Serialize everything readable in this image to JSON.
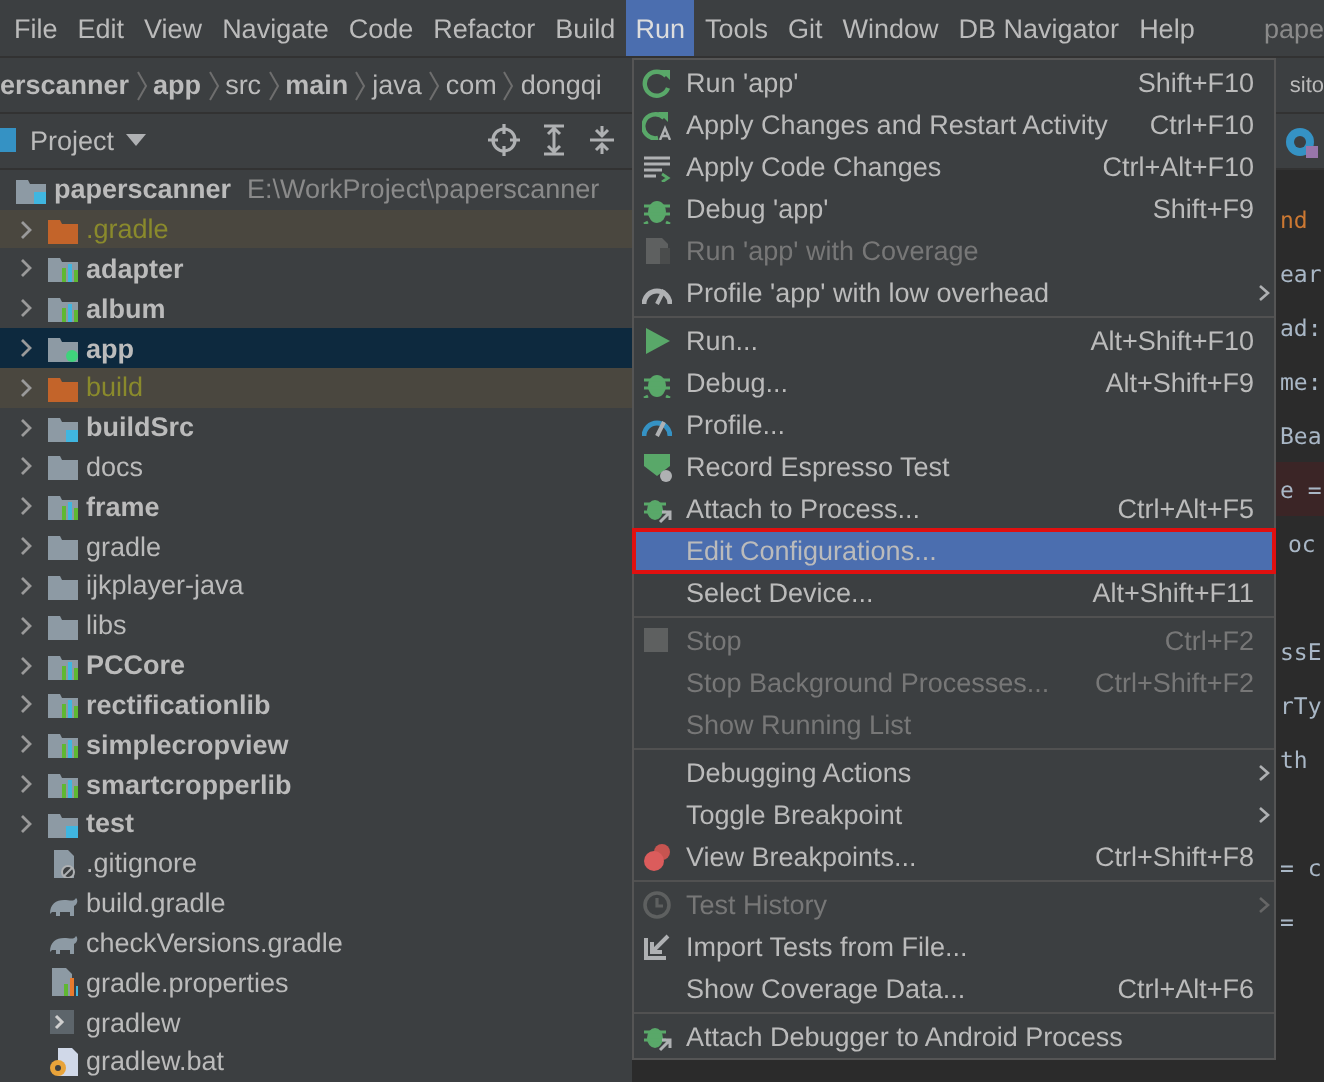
{
  "menu_bar": {
    "items": [
      {
        "label": "File",
        "selected": false
      },
      {
        "label": "Edit",
        "selected": false
      },
      {
        "label": "View",
        "selected": false
      },
      {
        "label": "Navigate",
        "selected": false
      },
      {
        "label": "Code",
        "selected": false
      },
      {
        "label": "Refactor",
        "selected": false
      },
      {
        "label": "Build",
        "selected": false
      },
      {
        "label": "Run",
        "selected": true
      },
      {
        "label": "Tools",
        "selected": false
      },
      {
        "label": "Git",
        "selected": false
      },
      {
        "label": "Window",
        "selected": false
      },
      {
        "label": "DB Navigator",
        "selected": false
      },
      {
        "label": "Help",
        "selected": false
      }
    ],
    "project_title": "pape"
  },
  "breadcrumb": {
    "items": [
      {
        "label": "erscanner",
        "bold": true
      },
      {
        "label": "app",
        "bold": true
      },
      {
        "label": "src",
        "bold": false
      },
      {
        "label": "main",
        "bold": true
      },
      {
        "label": "java",
        "bold": false
      },
      {
        "label": "com",
        "bold": false
      },
      {
        "label": "dongqi",
        "bold": false
      }
    ],
    "right_fragment": "sito"
  },
  "project_panel": {
    "title": "Project",
    "tree": [
      {
        "name": "paperscanner",
        "path": "E:\\WorkProject\\paperscanner",
        "kind": "source-root",
        "bold": true,
        "selected": false,
        "children": [
          {
            "name": ".gradle",
            "kind": "excluded",
            "bold": false,
            "selected": false,
            "expanded": false
          },
          {
            "name": "adapter",
            "kind": "module",
            "bold": true,
            "selected": false,
            "expanded": false
          },
          {
            "name": "album",
            "kind": "module",
            "bold": true,
            "selected": false,
            "expanded": false
          },
          {
            "name": "app",
            "kind": "app-module",
            "bold": true,
            "selected": true,
            "expanded": false
          },
          {
            "name": "build",
            "kind": "excluded",
            "bold": false,
            "selected": false,
            "expanded": false
          },
          {
            "name": "buildSrc",
            "kind": "source-root",
            "bold": true,
            "selected": false,
            "expanded": false
          },
          {
            "name": "docs",
            "kind": "folder",
            "bold": false,
            "selected": false,
            "expanded": false
          },
          {
            "name": "frame",
            "kind": "module",
            "bold": true,
            "selected": false,
            "expanded": false
          },
          {
            "name": "gradle",
            "kind": "folder",
            "bold": false,
            "selected": false,
            "expanded": false
          },
          {
            "name": "ijkplayer-java",
            "kind": "folder",
            "bold": false,
            "selected": false,
            "expanded": false
          },
          {
            "name": "libs",
            "kind": "folder",
            "bold": false,
            "selected": false,
            "expanded": false
          },
          {
            "name": "PCCore",
            "kind": "module",
            "bold": true,
            "selected": false,
            "expanded": false
          },
          {
            "name": "rectificationlib",
            "kind": "module",
            "bold": true,
            "selected": false,
            "expanded": false
          },
          {
            "name": "simplecropview",
            "kind": "module",
            "bold": true,
            "selected": false,
            "expanded": false
          },
          {
            "name": "smartcropperlib",
            "kind": "module",
            "bold": true,
            "selected": false,
            "expanded": false
          },
          {
            "name": "test",
            "kind": "source-root",
            "bold": true,
            "selected": false,
            "expanded": false
          },
          {
            "name": ".gitignore",
            "kind": "ignore-file",
            "bold": false,
            "selected": false
          },
          {
            "name": "build.gradle",
            "kind": "gradle-file",
            "bold": false,
            "selected": false
          },
          {
            "name": "checkVersions.gradle",
            "kind": "gradle-file",
            "bold": false,
            "selected": false
          },
          {
            "name": "gradle.properties",
            "kind": "properties-file",
            "bold": false,
            "selected": false
          },
          {
            "name": "gradlew",
            "kind": "script-file",
            "bold": false,
            "selected": false
          },
          {
            "name": "gradlew.bat",
            "kind": "batch-file",
            "bold": false,
            "selected": false
          }
        ]
      }
    ]
  },
  "editor": {
    "code_blocks": [
      [
        {
          "text": "nd",
          "kind": "keyword",
          "breakpoint": false
        },
        {
          "text": "ear",
          "kind": "plain",
          "breakpoint": false
        },
        {
          "text": "ad:",
          "kind": "plain",
          "breakpoint": false
        },
        {
          "text": "me:",
          "kind": "plain",
          "breakpoint": false
        },
        {
          "text": "Bea",
          "kind": "plain",
          "breakpoint": false
        },
        {
          "text": "e =",
          "kind": "plain",
          "breakpoint": true
        },
        {
          "text": "oc",
          "kind": "indented",
          "breakpoint": false
        }
      ],
      [
        {
          "text": "ssE",
          "kind": "plain",
          "breakpoint": false
        },
        {
          "text": "rTy",
          "kind": "plain",
          "breakpoint": false
        },
        {
          "text": "th",
          "kind": "plain",
          "breakpoint": false
        }
      ],
      [
        {
          "text": "= c",
          "kind": "plain",
          "breakpoint": false
        },
        {
          "text": "=",
          "kind": "plain",
          "breakpoint": false
        }
      ]
    ]
  },
  "run_menu": {
    "groups": [
      [
        {
          "label": "Run 'app'",
          "shortcut": "Shift+F10",
          "disabled": false,
          "selected": false,
          "submenu": false
        },
        {
          "label": "Apply Changes and Restart Activity",
          "shortcut": "Ctrl+F10",
          "disabled": false,
          "selected": false,
          "submenu": false
        },
        {
          "label": "Apply Code Changes",
          "shortcut": "Ctrl+Alt+F10",
          "disabled": false,
          "selected": false,
          "submenu": false
        },
        {
          "label": "Debug 'app'",
          "shortcut": "Shift+F9",
          "disabled": false,
          "selected": false,
          "submenu": false
        },
        {
          "label": "Run 'app' with Coverage",
          "disabled": true,
          "selected": false,
          "submenu": false
        },
        {
          "label": "Profile 'app' with low overhead",
          "disabled": false,
          "selected": false,
          "submenu": true
        }
      ],
      [
        {
          "label": "Run...",
          "shortcut": "Alt+Shift+F10",
          "disabled": false,
          "selected": false,
          "submenu": false
        },
        {
          "label": "Debug...",
          "shortcut": "Alt+Shift+F9",
          "disabled": false,
          "selected": false,
          "submenu": false
        },
        {
          "label": "Profile...",
          "disabled": false,
          "selected": false,
          "submenu": false
        },
        {
          "label": "Record Espresso Test",
          "disabled": false,
          "selected": false,
          "submenu": false
        },
        {
          "label": "Attach to Process...",
          "shortcut": "Ctrl+Alt+F5",
          "disabled": false,
          "selected": false,
          "submenu": false
        },
        {
          "label": "Edit Configurations...",
          "disabled": false,
          "selected": true,
          "outlined": true,
          "submenu": false
        },
        {
          "label": "Select Device...",
          "shortcut": "Alt+Shift+F11",
          "disabled": false,
          "selected": false,
          "submenu": false
        }
      ],
      [
        {
          "label": "Stop",
          "shortcut": "Ctrl+F2",
          "disabled": true,
          "selected": false,
          "submenu": false
        },
        {
          "label": "Stop Background Processes...",
          "shortcut": "Ctrl+Shift+F2",
          "disabled": true,
          "selected": false,
          "submenu": false
        },
        {
          "label": "Show Running List",
          "disabled": true,
          "selected": false,
          "submenu": false
        }
      ],
      [
        {
          "label": "Debugging Actions",
          "disabled": false,
          "selected": false,
          "submenu": true
        },
        {
          "label": "Toggle Breakpoint",
          "disabled": false,
          "selected": false,
          "submenu": true
        },
        {
          "label": "View Breakpoints...",
          "shortcut": "Ctrl+Shift+F8",
          "disabled": false,
          "selected": false,
          "submenu": false
        }
      ],
      [
        {
          "label": "Test History",
          "disabled": true,
          "selected": false,
          "submenu": true
        },
        {
          "label": "Import Tests from File...",
          "disabled": false,
          "selected": false,
          "submenu": false
        },
        {
          "label": "Show Coverage Data...",
          "shortcut": "Ctrl+Alt+F6",
          "disabled": false,
          "selected": false,
          "submenu": false
        }
      ],
      [
        {
          "label": "Attach Debugger to Android Process",
          "disabled": false,
          "selected": false,
          "submenu": false
        }
      ]
    ]
  }
}
